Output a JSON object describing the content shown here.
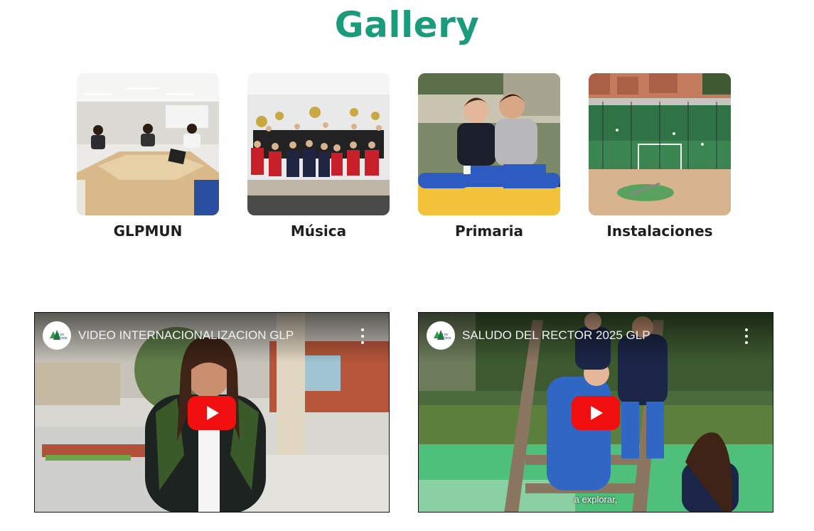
{
  "page": {
    "title": "Gallery"
  },
  "gallery": [
    {
      "label": "GLPMUN",
      "image": "classroom-students-photo"
    },
    {
      "label": "Música",
      "image": "band-students-photo"
    },
    {
      "label": "Primaria",
      "image": "two-students-photo"
    },
    {
      "label": "Instalaciones",
      "image": "sports-field-photo"
    }
  ],
  "videos": [
    {
      "title": "VIDEO INTERNACIONALIZACION GLP",
      "caption": "",
      "channel": "Los Pinos"
    },
    {
      "title": "SALUDO DEL RECTOR 2025 GLP",
      "caption": "a explorar,",
      "channel": "Los Pinos"
    }
  ],
  "colors": {
    "title": "#1a9c7c",
    "play": "#f10e0e"
  }
}
